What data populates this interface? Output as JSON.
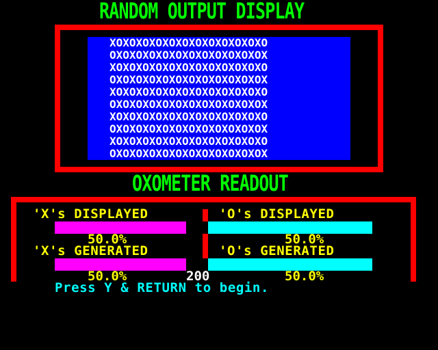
{
  "display": {
    "title": "RANDOM OUTPUT DISPLAY",
    "grid_rows": [
      "XOXOXOXOXOXOXOXOXOXOXOXO",
      "OXOXOXOXOXOXOXOXOXOXOXOX",
      "XOXOXOXOXOXOXOXOXOXOXOXO",
      "OXOXOXOXOXOXOXOXOXOXOXOX",
      "XOXOXOXOXOXOXOXOXOXOXOXO",
      "OXOXOXOXOXOXOXOXOXOXOXOX",
      "XOXOXOXOXOXOXOXOXOXOXOXO",
      "OXOXOXOXOXOXOXOXOXOXOXOX",
      "XOXOXOXOXOXOXOXOXOXOXOXO",
      "OXOXOXOXOXOXOXOXOXOXOXOX"
    ]
  },
  "readout": {
    "title": "OXOMETER READOUT",
    "x_displayed_label": "'X's DISPLAYED",
    "o_displayed_label": "'O's DISPLAYED",
    "x_generated_label": "'X's GENERATED",
    "o_generated_label": "'O's GENERATED",
    "x_displayed_pct": "50.0%",
    "o_displayed_pct": "50.0%",
    "x_generated_pct": "50.0%",
    "o_generated_pct": "50.0%",
    "generated_count": "200",
    "levels": {
      "x_displayed": 0.5,
      "o_displayed": 0.5,
      "x_generated": 0.5,
      "o_generated": 0.5
    }
  },
  "prompt": "Press Y & RETURN to begin.",
  "colors": {
    "background": "#000000",
    "title": "#00ff00",
    "frame": "#ff0000",
    "panel": "#0000ff",
    "grid_text": "#ffffff",
    "labels": "#ffff00",
    "x_bar": "#ff00ff",
    "o_bar": "#00ffff",
    "prompt": "#00ffff"
  }
}
